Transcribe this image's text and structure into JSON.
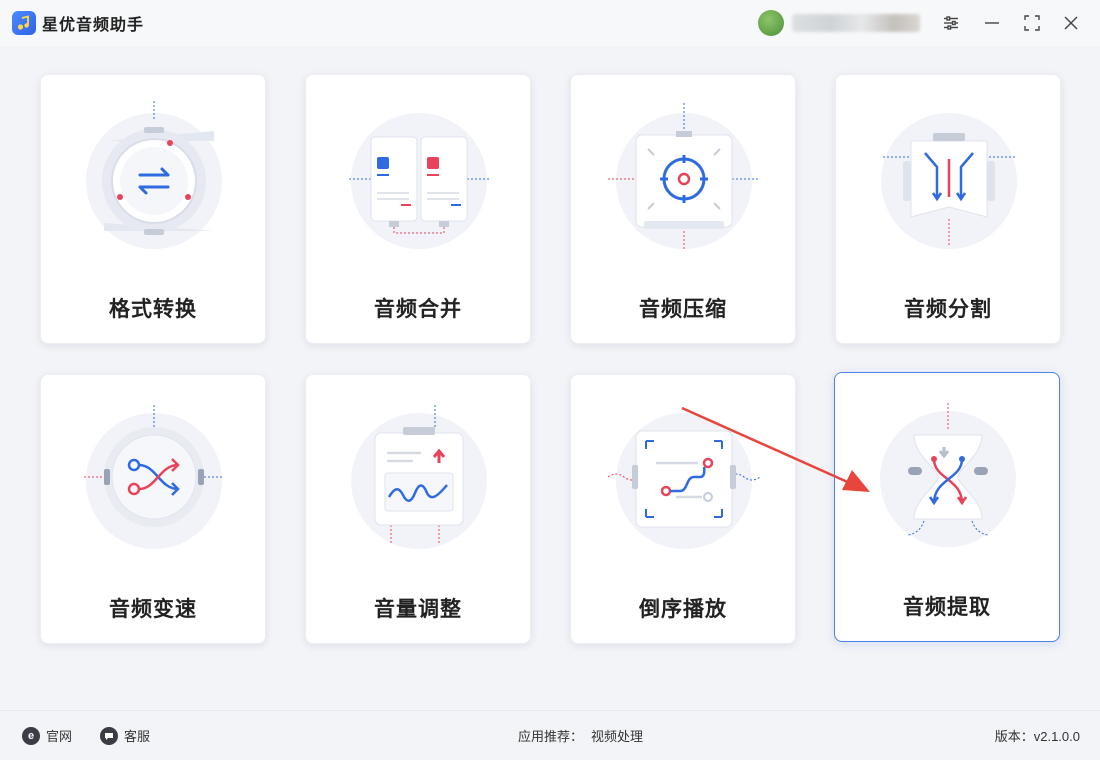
{
  "app": {
    "title": "星优音频助手"
  },
  "user": {
    "avatar": "user-avatar",
    "name": ""
  },
  "window_controls": [
    "settings-icon",
    "minimize-icon",
    "maximize-icon",
    "close-icon"
  ],
  "features": [
    {
      "label": "格式转换",
      "icon": "format-convert-icon"
    },
    {
      "label": "音频合并",
      "icon": "audio-merge-icon"
    },
    {
      "label": "音频压缩",
      "icon": "audio-compress-icon"
    },
    {
      "label": "音频分割",
      "icon": "audio-split-icon"
    },
    {
      "label": "音频变速",
      "icon": "audio-speed-icon"
    },
    {
      "label": "音量调整",
      "icon": "volume-adjust-icon"
    },
    {
      "label": "倒序播放",
      "icon": "reverse-play-icon"
    },
    {
      "label": "音频提取",
      "icon": "audio-extract-icon",
      "selected": true
    }
  ],
  "footer": {
    "website_label": "官网",
    "support_label": "客服",
    "recommend_label": "应用推荐：",
    "recommend_link": "视频处理",
    "version_label": "版本：v2.1.0.0"
  },
  "colors": {
    "accent": "#4a84e8",
    "blue": "#2f6be0",
    "red": "#e8435a",
    "card_bg": "#ffffff",
    "page_bg": "#f3f4f7",
    "annotation_arrow": "#e8453c"
  }
}
